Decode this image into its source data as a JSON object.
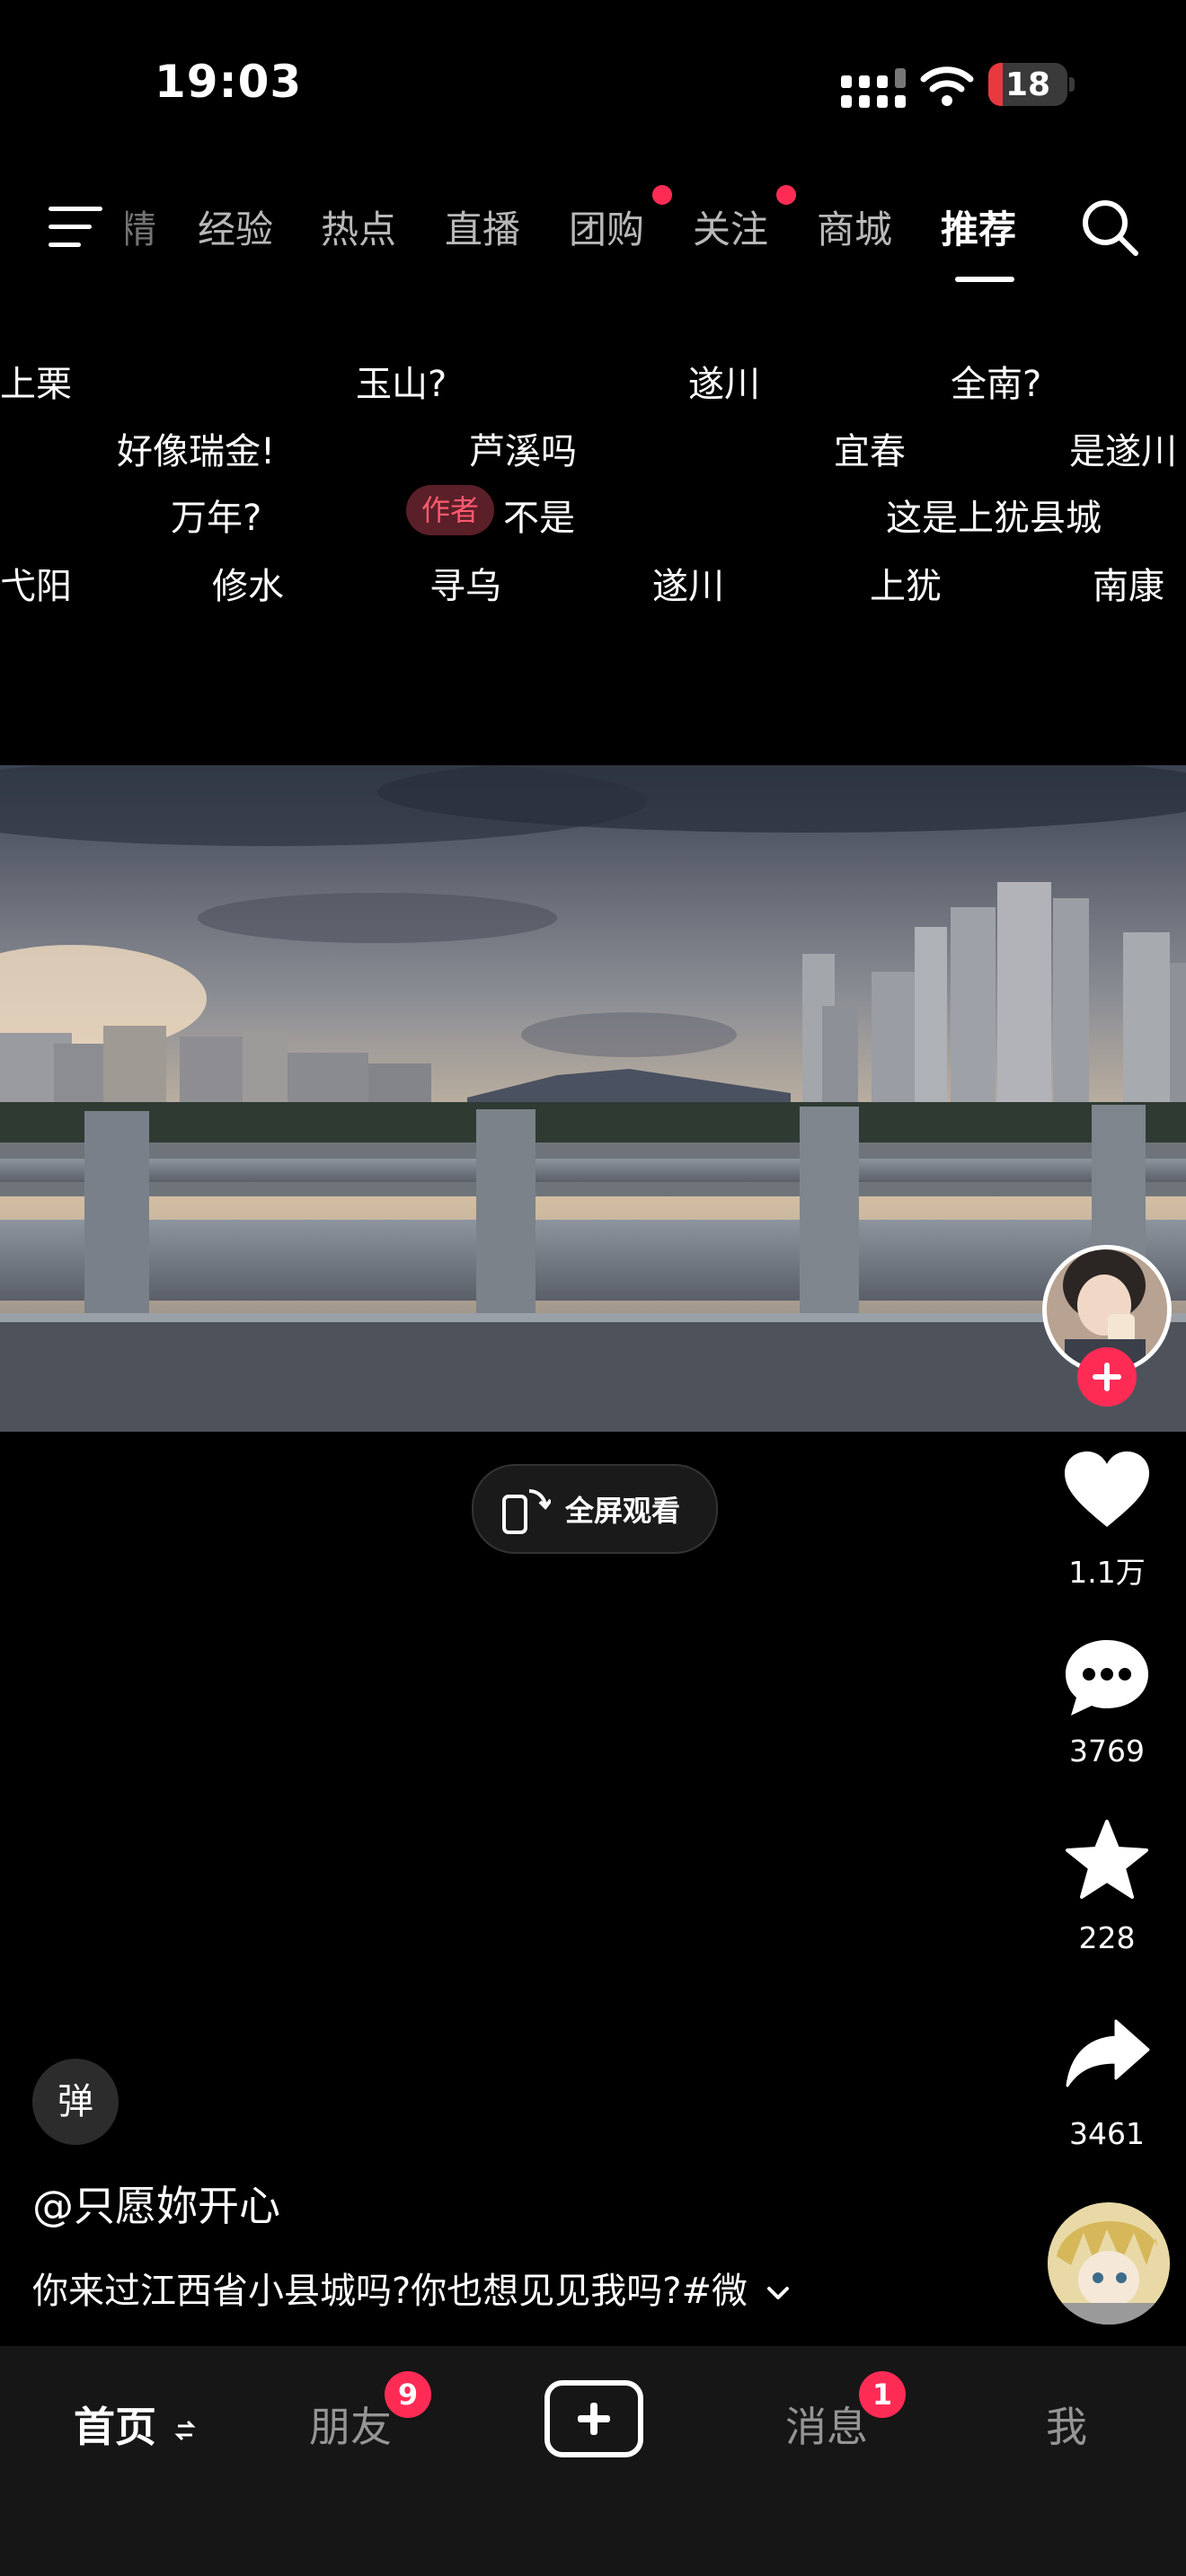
{
  "status_bar": {
    "time": "19:03",
    "battery_level": "18",
    "battery_fraction": 0.18
  },
  "top_tabs": {
    "cut_tab": "精",
    "items": [
      {
        "label": "经验",
        "dot": false
      },
      {
        "label": "热点",
        "dot": false
      },
      {
        "label": "直播",
        "dot": false
      },
      {
        "label": "团购",
        "dot": true
      },
      {
        "label": "关注",
        "dot": true
      },
      {
        "label": "商城",
        "dot": false
      },
      {
        "label": "推荐",
        "dot": false,
        "active": true
      }
    ]
  },
  "danmaku": [
    {
      "text": "上栗"
    },
    {
      "text": "玉山?"
    },
    {
      "text": "遂川"
    },
    {
      "text": "全南?"
    },
    {
      "text": "好像瑞金!"
    },
    {
      "text": "芦溪吗"
    },
    {
      "text": "宜春"
    },
    {
      "text": "是遂川"
    },
    {
      "text": "万年?"
    },
    {
      "text": "不是",
      "author_tag": "作者"
    },
    {
      "text": "这是上犹县城"
    },
    {
      "text": "弋阳"
    },
    {
      "text": "修水"
    },
    {
      "text": "寻乌"
    },
    {
      "text": "遂川"
    },
    {
      "text": "上犹"
    },
    {
      "text": "南康"
    }
  ],
  "video": {
    "fullscreen_label": "全屏观看"
  },
  "actions": {
    "like_count": "1.1万",
    "comment_count": "3769",
    "favorite_count": "228",
    "share_count": "3461"
  },
  "danmaku_toggle_label": "弹",
  "post": {
    "username": "@只愿妳开心",
    "caption": "你来过江西省小县城吗?你也想见见我吗?#微"
  },
  "bottom_nav": {
    "home": "首页",
    "friends": "朋友",
    "friends_badge": "9",
    "messages": "消息",
    "messages_badge": "1",
    "me": "我"
  },
  "colors": {
    "accent": "#fe2c55",
    "background": "#000000"
  }
}
